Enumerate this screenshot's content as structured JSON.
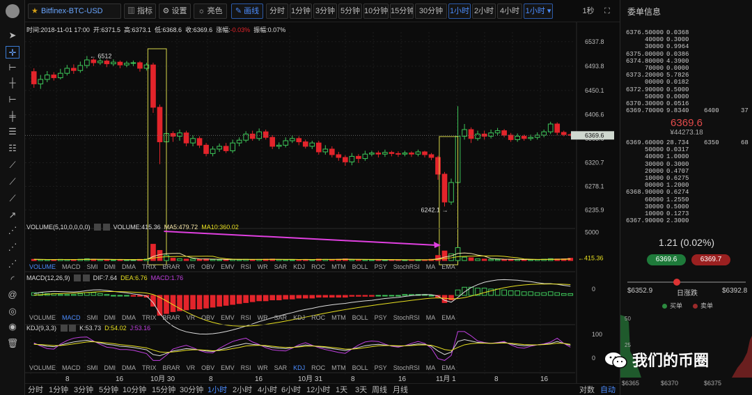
{
  "toolbar": {
    "symbol": "Bitfinex-BTC-USD",
    "indicator_label": "指标",
    "settings_label": "设置",
    "theme_label": "亮色",
    "draw_label": "画线",
    "intervals": [
      "分时",
      "1分钟",
      "3分钟",
      "5分钟",
      "10分钟",
      "15分钟",
      "30分钟",
      "1小时",
      "2小时",
      "4小时"
    ],
    "active_interval": "1小时",
    "interval_dropdown": "1小时",
    "countdown": "1秒"
  },
  "info_line": {
    "time": "时间:2018-11-01 17:00",
    "open": "开:6371.5",
    "high": "高:6373.1",
    "low": "低:6368.6",
    "close": "收:6369.6",
    "change_label": "涨幅:",
    "change": "-0.03%",
    "amp": "振幅:0.07%"
  },
  "volume_line": {
    "title": "VOLUME(5,10,0,0,0,0)",
    "vol": "VOLUME:415.36",
    "ma5": "MA5:479.72",
    "ma10": "MA10:360.02"
  },
  "macd_line": {
    "title": "MACD(12,26,9)",
    "dif": "DIF:7.64",
    "dea": "DEA:6.76",
    "macd": "MACD:1.76"
  },
  "kdj_line": {
    "title": "KDJ(9,3,3)",
    "k": "K:53.73",
    "d": "D:54.02",
    "j": "J:53.16"
  },
  "indicator_tabs": [
    "VOLUME",
    "MACD",
    "SMI",
    "DMI",
    "DMA",
    "TRIX",
    "BRAR",
    "VR",
    "OBV",
    "EMV",
    "RSI",
    "WR",
    "SAR",
    "KDJ",
    "ROC",
    "MTM",
    "BOLL",
    "PSY",
    "StochRSI",
    "MA",
    "EMA"
  ],
  "bottom_bar": {
    "periods": [
      "分时",
      "1分钟",
      "3分钟",
      "5分钟",
      "10分钟",
      "15分钟",
      "30分钟",
      "1小时",
      "2小时",
      "4小时",
      "6小时",
      "12小时",
      "1天",
      "3天",
      "周线",
      "月线"
    ],
    "active_period": "1小时",
    "log_label": "对数",
    "auto_label": "自动"
  },
  "right_panel": {
    "title": "委单信息",
    "last_price": "6369.6",
    "last_cny": "¥44273.18",
    "change_text": "1.21 (0.02%)",
    "buy_btn": "6369.6",
    "sell_btn": "6369.7",
    "range_low": "$6352.9",
    "range_label": "日涨跌",
    "range_high": "$6392.8",
    "buy_legend": "买单",
    "sell_legend": "卖单",
    "depth_ticks": [
      "$6365",
      "$6370",
      "$6375"
    ],
    "depth_y": [
      "50",
      "25"
    ]
  },
  "watermark": "我们的币圈",
  "colors": {
    "up": "#3ec85a",
    "down": "#e3242b",
    "accent": "#4c8dff",
    "ma5": "#f5e6a8",
    "ma10": "#e8e020",
    "purple": "#c040e0"
  },
  "chart_data": {
    "type": "candlestick",
    "price_axis": [
      6537.8,
      6493.8,
      6450.1,
      6406.6,
      6363.6,
      6320.7,
      6278.1,
      6235.9
    ],
    "price_range": [
      6220,
      6555
    ],
    "current_price": "6369.6",
    "high_annotation": "6512",
    "low_annotation": "6242.1",
    "x_labels": [
      "8",
      "16",
      "10月 30",
      "8",
      "16",
      "10月 31",
      "8",
      "16",
      "11月 1",
      "8",
      "16"
    ],
    "volume_axis": [
      "5000"
    ],
    "volume_current": "415.36",
    "volume_range": [
      0,
      5200
    ],
    "macd_axis": [
      "0"
    ],
    "kdj_axis": [
      "100",
      "0"
    ],
    "candles": [
      [
        6484,
        6462,
        6490,
        6455
      ],
      [
        6462,
        6470,
        6478,
        6453
      ],
      [
        6470,
        6478,
        6485,
        6465
      ],
      [
        6478,
        6473,
        6483,
        6468
      ],
      [
        6473,
        6481,
        6489,
        6470
      ],
      [
        6481,
        6490,
        6496,
        6477
      ],
      [
        6490,
        6486,
        6497,
        6480
      ],
      [
        6486,
        6495,
        6502,
        6482
      ],
      [
        6495,
        6505,
        6512,
        6490
      ],
      [
        6505,
        6500,
        6508,
        6494
      ],
      [
        6500,
        6503,
        6508,
        6496
      ],
      [
        6503,
        6498,
        6506,
        6492
      ],
      [
        6498,
        6501,
        6506,
        6494
      ],
      [
        6501,
        6496,
        6504,
        6490
      ],
      [
        6496,
        6499,
        6503,
        6492
      ],
      [
        6499,
        6500,
        6504,
        6494
      ],
      [
        6500,
        6490,
        6503,
        6484
      ],
      [
        6490,
        6496,
        6500,
        6486
      ],
      [
        6496,
        6420,
        6500,
        6410
      ],
      [
        6420,
        6358,
        6425,
        6318
      ],
      [
        6358,
        6373,
        6392,
        6345
      ],
      [
        6373,
        6368,
        6377,
        6358
      ],
      [
        6368,
        6374,
        6380,
        6360
      ],
      [
        6374,
        6356,
        6378,
        6350
      ],
      [
        6356,
        6364,
        6370,
        6350
      ],
      [
        6364,
        6352,
        6368,
        6347
      ],
      [
        6352,
        6337,
        6356,
        6332
      ],
      [
        6337,
        6345,
        6350,
        6332
      ],
      [
        6345,
        6350,
        6355,
        6340
      ],
      [
        6350,
        6342,
        6356,
        6338
      ],
      [
        6342,
        6356,
        6362,
        6338
      ],
      [
        6356,
        6361,
        6366,
        6350
      ],
      [
        6361,
        6372,
        6377,
        6357
      ],
      [
        6372,
        6364,
        6378,
        6360
      ],
      [
        6364,
        6376,
        6382,
        6360
      ],
      [
        6376,
        6366,
        6380,
        6362
      ],
      [
        6366,
        6350,
        6370,
        6345
      ],
      [
        6350,
        6352,
        6357,
        6345
      ],
      [
        6352,
        6360,
        6366,
        6348
      ],
      [
        6360,
        6364,
        6369,
        6356
      ],
      [
        6364,
        6358,
        6368,
        6352
      ],
      [
        6358,
        6350,
        6362,
        6346
      ],
      [
        6350,
        6356,
        6360,
        6345
      ],
      [
        6356,
        6340,
        6360,
        6335
      ],
      [
        6340,
        6345,
        6352,
        6335
      ],
      [
        6345,
        6335,
        6350,
        6330
      ],
      [
        6335,
        6330,
        6340,
        6324
      ],
      [
        6330,
        6322,
        6334,
        6315
      ],
      [
        6322,
        6332,
        6338,
        6316
      ],
      [
        6332,
        6328,
        6336,
        6320
      ],
      [
        6328,
        6336,
        6342,
        6324
      ],
      [
        6336,
        6338,
        6342,
        6332
      ],
      [
        6338,
        6336,
        6342,
        6330
      ],
      [
        6336,
        6339,
        6344,
        6331
      ],
      [
        6339,
        6337,
        6342,
        6332
      ],
      [
        6337,
        6336,
        6341,
        6331
      ],
      [
        6336,
        6338,
        6342,
        6332
      ],
      [
        6338,
        6336,
        6341,
        6331
      ],
      [
        6336,
        6340,
        6344,
        6332
      ],
      [
        6340,
        6335,
        6342,
        6330
      ],
      [
        6335,
        6330,
        6338,
        6325
      ],
      [
        6330,
        6300,
        6333,
        6290
      ],
      [
        6300,
        6250,
        6304,
        6242
      ],
      [
        6250,
        6285,
        6292,
        6245
      ],
      [
        6285,
        6368,
        6422,
        6280
      ],
      [
        6368,
        6380,
        6390,
        6362
      ],
      [
        6380,
        6364,
        6384,
        6356
      ],
      [
        6364,
        6372,
        6378,
        6360
      ],
      [
        6372,
        6368,
        6378,
        6362
      ],
      [
        6368,
        6374,
        6380,
        6364
      ],
      [
        6374,
        6378,
        6383,
        6369
      ],
      [
        6378,
        6370,
        6381,
        6366
      ],
      [
        6370,
        6362,
        6374,
        6358
      ],
      [
        6362,
        6368,
        6373,
        6358
      ],
      [
        6368,
        6364,
        6371,
        6360
      ],
      [
        6364,
        6366,
        6371,
        6360
      ],
      [
        6366,
        6370,
        6375,
        6362
      ],
      [
        6370,
        6376,
        6380,
        6366
      ],
      [
        6376,
        6390,
        6394,
        6372
      ],
      [
        6390,
        6375,
        6393,
        6370
      ],
      [
        6375,
        6371,
        6378,
        6368
      ],
      [
        6371,
        6370,
        6373,
        6368
      ]
    ],
    "volumes": [
      220,
      180,
      160,
      140,
      210,
      190,
      150,
      230,
      320,
      250,
      170,
      150,
      120,
      180,
      140,
      130,
      210,
      260,
      2900,
      1800,
      950,
      420,
      310,
      260,
      280,
      220,
      300,
      190,
      150,
      180,
      210,
      160,
      220,
      190,
      200,
      240,
      270,
      180,
      150,
      140,
      160,
      190,
      170,
      260,
      200,
      210,
      240,
      300,
      180,
      160,
      150,
      140,
      130,
      120,
      150,
      140,
      130,
      120,
      160,
      140,
      230,
      900,
      1700,
      1200,
      2300,
      600,
      500,
      300,
      260,
      220,
      200,
      180,
      210,
      190,
      170,
      160,
      180,
      240,
      330,
      280,
      300,
      415
    ],
    "macd_hist": [
      3,
      3,
      2,
      2,
      1,
      1,
      1,
      2,
      3,
      3,
      2,
      1,
      0,
      0,
      0,
      -1,
      -1,
      -2,
      -12,
      -22,
      -20,
      -18,
      -17,
      -16,
      -15,
      -15,
      -14,
      -13,
      -12,
      -11,
      -10,
      -9,
      -8,
      -7,
      -6,
      -6,
      -5,
      -5,
      -4,
      -4,
      -3,
      -3,
      -3,
      -2,
      -2,
      -2,
      -2,
      -2,
      -1,
      -1,
      -1,
      -1,
      0,
      0,
      0,
      0,
      1,
      1,
      1,
      1,
      0,
      -2,
      -8,
      -5,
      6,
      9,
      9,
      8,
      8,
      7,
      7,
      6,
      5,
      5,
      4,
      4,
      3,
      3,
      4,
      3,
      2,
      2
    ],
    "kdj_k": [
      60,
      55,
      50,
      48,
      55,
      62,
      68,
      72,
      75,
      70,
      64,
      58,
      55,
      50,
      48,
      45,
      40,
      35,
      15,
      10,
      20,
      30,
      35,
      40,
      38,
      34,
      30,
      28,
      35,
      42,
      50,
      56,
      62,
      58,
      55,
      50,
      45,
      42,
      40,
      44,
      50,
      55,
      52,
      48,
      44,
      40,
      36,
      32,
      38,
      45,
      52,
      56,
      58,
      55,
      52,
      50,
      52,
      56,
      60,
      58,
      50,
      30,
      15,
      25,
      70,
      78,
      72,
      66,
      64,
      62,
      64,
      66,
      60,
      55,
      52,
      54,
      56,
      58,
      62,
      70,
      62,
      54
    ],
    "kdj_d": [
      58,
      57,
      55,
      53,
      53,
      56,
      60,
      64,
      68,
      69,
      67,
      64,
      61,
      57,
      54,
      51,
      47,
      43,
      34,
      26,
      24,
      26,
      29,
      33,
      35,
      35,
      33,
      31,
      32,
      35,
      40,
      45,
      51,
      53,
      54,
      53,
      50,
      47,
      45,
      45,
      47,
      50,
      51,
      50,
      48,
      45,
      42,
      38,
      38,
      40,
      44,
      48,
      52,
      53,
      53,
      52,
      52,
      53,
      55,
      56,
      54,
      46,
      36,
      32,
      45,
      56,
      61,
      63,
      63,
      62,
      63,
      64,
      62,
      60,
      57,
      56,
      56,
      57,
      59,
      63,
      62,
      58
    ],
    "kdj_j": [
      64,
      51,
      40,
      38,
      59,
      74,
      84,
      88,
      89,
      72,
      58,
      46,
      43,
      36,
      36,
      33,
      26,
      19,
      -23,
      -22,
      12,
      38,
      47,
      54,
      44,
      32,
      24,
      22,
      41,
      56,
      70,
      78,
      84,
      68,
      57,
      44,
      35,
      32,
      30,
      42,
      56,
      65,
      54,
      44,
      36,
      30,
      24,
      20,
      38,
      55,
      68,
      72,
      70,
      59,
      50,
      46,
      52,
      62,
      70,
      62,
      42,
      -2,
      -27,
      11,
      120,
      122,
      94,
      72,
      66,
      62,
      66,
      70,
      56,
      45,
      42,
      50,
      56,
      60,
      68,
      84,
      62,
      46
    ]
  },
  "orderbook": {
    "asks": [
      [
        "6376.5",
        "0000",
        "0.0368"
      ],
      [
        "4",
        "0000",
        "0.3000"
      ],
      [
        "3",
        "0000",
        "0.9964"
      ],
      [
        "6375.0",
        "0000",
        "0.0386"
      ],
      [
        "6374.8",
        "0000",
        "4.3900"
      ],
      [
        "7",
        "0000",
        "0.0000"
      ],
      [
        "6373.2",
        "0000",
        "5.7826"
      ],
      [
        "0",
        "0000",
        "0.0182"
      ],
      [
        "6372.9",
        "0000",
        "0.5000"
      ],
      [
        "5",
        "0000",
        "0.0000"
      ],
      [
        "6370.3",
        "0000",
        "0.0516"
      ],
      [
        "6369.7",
        "0000",
        "9.8340"
      ]
    ],
    "ask_depth": [
      [
        "6400",
        "37"
      ]
    ],
    "bids": [
      [
        "6369.6",
        "0000",
        "28.734"
      ],
      [
        "5",
        "0000",
        "0.0317"
      ],
      [
        "4",
        "0000",
        "1.0000"
      ],
      [
        "3",
        "0000",
        "0.3000"
      ],
      [
        "2",
        "0000",
        "0.4707"
      ],
      [
        "1",
        "0000",
        "0.6275"
      ],
      [
        "0",
        "0000",
        "1.2000"
      ],
      [
        "6368.9",
        "0000",
        "0.6274"
      ],
      [
        "6",
        "0000",
        "1.2550"
      ],
      [
        "3",
        "0000",
        "0.5000"
      ],
      [
        "1",
        "0000",
        "0.1273"
      ],
      [
        "6367.9",
        "0000",
        "2.3000"
      ]
    ],
    "bid_depth": [
      [
        "6350",
        "68"
      ]
    ]
  }
}
